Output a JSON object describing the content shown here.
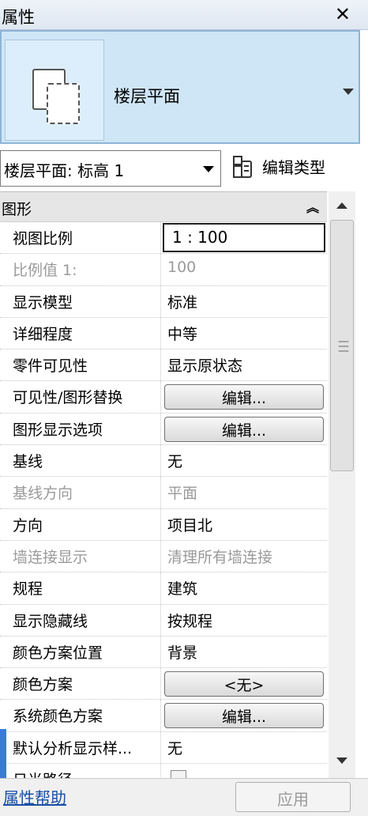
{
  "panel": {
    "title": "属性",
    "close": "✕"
  },
  "type_selector": {
    "name": "楼层平面"
  },
  "instance": {
    "value": "楼层平面: 标高 1",
    "edit_type_label": "编辑类型"
  },
  "group": {
    "title": "图形",
    "collapse_glyph": "⌃⌃"
  },
  "properties": [
    {
      "name": "视图比例",
      "value": "1 : 100"
    },
    {
      "name": "比例值 1:",
      "value": "100"
    },
    {
      "name": "显示模型",
      "value": "标准"
    },
    {
      "name": "详细程度",
      "value": "中等"
    },
    {
      "name": "零件可见性",
      "value": "显示原状态"
    },
    {
      "name": "可见性/图形替换",
      "value": "编辑..."
    },
    {
      "name": "图形显示选项",
      "value": "编辑..."
    },
    {
      "name": "基线",
      "value": "无"
    },
    {
      "name": "基线方向",
      "value": "平面"
    },
    {
      "name": "方向",
      "value": "项目北"
    },
    {
      "name": "墙连接显示",
      "value": "清理所有墙连接"
    },
    {
      "name": "规程",
      "value": "建筑"
    },
    {
      "name": "显示隐藏线",
      "value": "按规程"
    },
    {
      "name": "颜色方案位置",
      "value": "背景"
    },
    {
      "name": "颜色方案",
      "value": "<无>"
    },
    {
      "name": "系统颜色方案",
      "value": "编辑..."
    },
    {
      "name": "默认分析显示样...",
      "value": "无"
    },
    {
      "name": "日光路径",
      "value": ""
    }
  ],
  "footer": {
    "help": "属性帮助",
    "apply": "应用"
  }
}
